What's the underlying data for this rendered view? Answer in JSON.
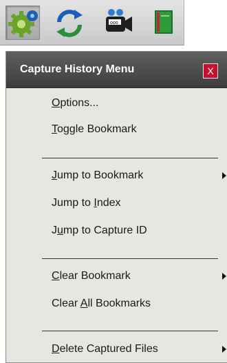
{
  "toolbar": {
    "buttons": [
      {
        "icon": "settings-gear-icon",
        "active": true
      },
      {
        "icon": "refresh-arrows-icon",
        "active": false
      },
      {
        "icon": "video-camera-icon",
        "active": false
      },
      {
        "icon": "green-book-icon",
        "active": false
      }
    ]
  },
  "menu": {
    "title": "Capture History Menu",
    "close_label": "X",
    "items": [
      {
        "pre": "",
        "u": "O",
        "post": "ptions...",
        "submenu": false
      },
      {
        "pre": "",
        "u": "T",
        "post": "oggle Bookmark",
        "submenu": false
      },
      {
        "pre": "",
        "u": "J",
        "post": "ump to Bookmark",
        "submenu": true
      },
      {
        "pre": "Jump to ",
        "u": "I",
        "post": "ndex",
        "submenu": false
      },
      {
        "pre": "J",
        "u": "u",
        "post": "mp to Capture ID",
        "submenu": false
      },
      {
        "pre": "",
        "u": "C",
        "post": "lear Bookmark",
        "submenu": true
      },
      {
        "pre": "Clear ",
        "u": "A",
        "post": "ll Bookmarks",
        "submenu": false
      },
      {
        "pre": "",
        "u": "D",
        "post": "elete Captured Files",
        "submenu": true
      }
    ]
  },
  "colors": {
    "title_bar": "#4a4a4a",
    "menu_bg": "#e8e6e1",
    "close_bg": "#c8102e",
    "gear_green": "#6aa329",
    "arrow_blue": "#1b5fb8",
    "book_green": "#2e9b3a"
  }
}
